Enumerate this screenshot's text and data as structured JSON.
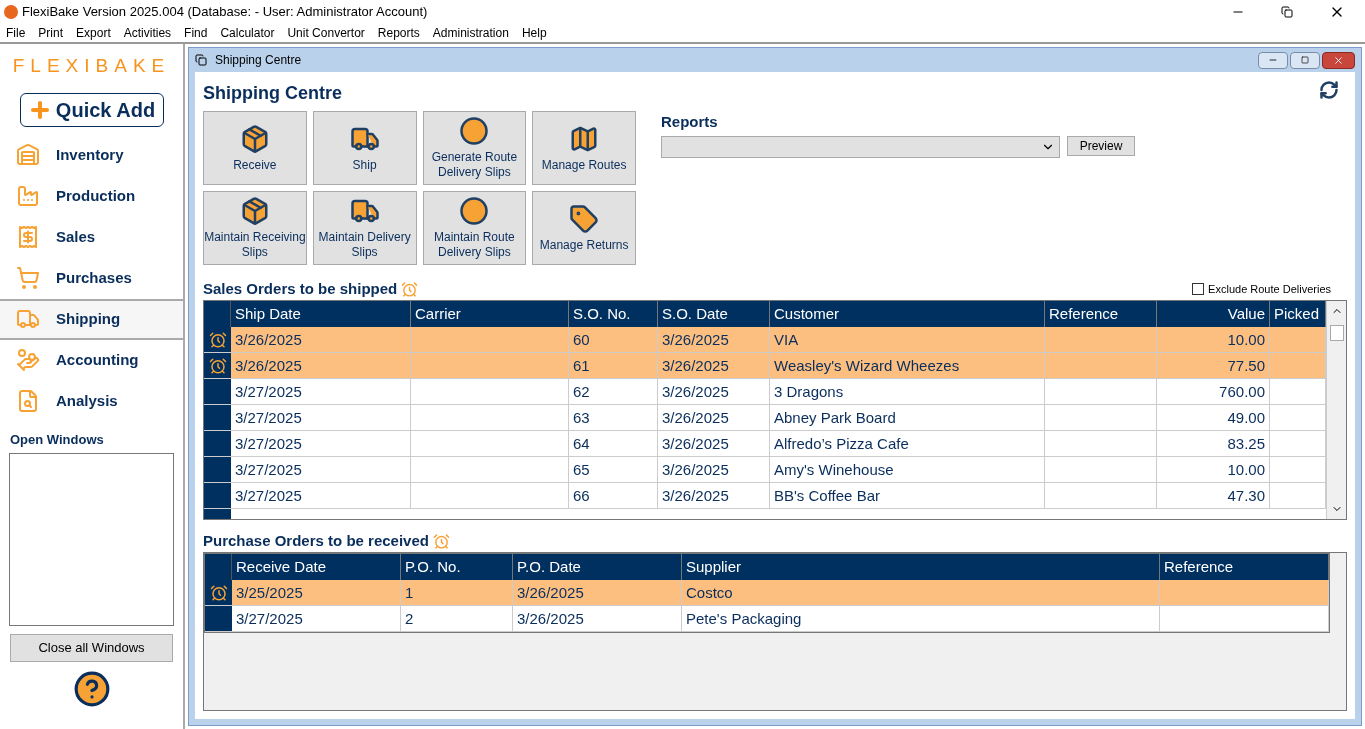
{
  "app_title": "FlexiBake Version 2025.004 (Database:  - User: Administrator Account)",
  "menu": [
    "File",
    "Print",
    "Export",
    "Activities",
    "Find",
    "Calculator",
    "Unit Convertor",
    "Reports",
    "Administration",
    "Help"
  ],
  "sidebar": {
    "logo": "FLEXIBAKE",
    "quick_add": "Quick Add",
    "items": [
      {
        "label": "Inventory",
        "kind": "inventory",
        "selected": false
      },
      {
        "label": "Production",
        "kind": "production",
        "selected": false
      },
      {
        "label": "Sales",
        "kind": "sales",
        "selected": false
      },
      {
        "label": "Purchases",
        "kind": "purchases",
        "selected": false
      },
      {
        "label": "Shipping",
        "kind": "shipping",
        "selected": true
      },
      {
        "label": "Accounting",
        "kind": "accounting",
        "selected": false
      },
      {
        "label": "Analysis",
        "kind": "analysis",
        "selected": false
      }
    ],
    "open_windows_label": "Open Windows",
    "close_all": "Close all Windows"
  },
  "window": {
    "title": "Shipping Centre",
    "heading": "Shipping Centre",
    "actions": [
      {
        "label": "Receive",
        "kind": "receive"
      },
      {
        "label": "Ship",
        "kind": "ship"
      },
      {
        "label": "Generate Route Delivery Slips",
        "kind": "route"
      },
      {
        "label": "Manage Routes",
        "kind": "map"
      },
      {
        "label": "Maintain Receiving Slips",
        "kind": "receive"
      },
      {
        "label": "Maintain Delivery Slips",
        "kind": "ship"
      },
      {
        "label": "Maintain Route Delivery Slips",
        "kind": "route"
      },
      {
        "label": "Manage Returns",
        "kind": "tag"
      }
    ],
    "reports": {
      "label": "Reports",
      "preview": "Preview"
    },
    "sales": {
      "title": "Sales Orders to be shipped",
      "exclude": {
        "label": "Exclude Route Deliveries",
        "checked": false
      },
      "columns": [
        "Ship Date",
        "Carrier",
        "S.O. No.",
        "S.O. Date",
        "Customer",
        "Reference",
        "Value",
        "Picked"
      ],
      "rows": [
        {
          "alarm": true,
          "cells": [
            "3/26/2025",
            "",
            "60",
            "3/26/2025",
            "VIA",
            "",
            "10.00",
            ""
          ]
        },
        {
          "alarm": true,
          "cells": [
            "3/26/2025",
            "",
            "61",
            "3/26/2025",
            "Weasley's Wizard Wheezes",
            "",
            "77.50",
            ""
          ]
        },
        {
          "alarm": false,
          "cells": [
            "3/27/2025",
            "",
            "62",
            "3/26/2025",
            "3 Dragons",
            "",
            "760.00",
            ""
          ]
        },
        {
          "alarm": false,
          "cells": [
            "3/27/2025",
            "",
            "63",
            "3/26/2025",
            "Abney Park Board",
            "",
            "49.00",
            ""
          ]
        },
        {
          "alarm": false,
          "cells": [
            "3/27/2025",
            "",
            "64",
            "3/26/2025",
            "Alfredo’s Pizza Cafe",
            "",
            "83.25",
            ""
          ]
        },
        {
          "alarm": false,
          "cells": [
            "3/27/2025",
            "",
            "65",
            "3/26/2025",
            "Amy's Winehouse",
            "",
            "10.00",
            ""
          ]
        },
        {
          "alarm": false,
          "cells": [
            "3/27/2025",
            "",
            "66",
            "3/26/2025",
            "BB's Coffee Bar",
            "",
            "47.30",
            ""
          ]
        }
      ]
    },
    "purchases": {
      "title": "Purchase Orders to be received",
      "columns": [
        "Receive Date",
        "P.O. No.",
        "P.O. Date",
        "Supplier",
        "Reference"
      ],
      "rows": [
        {
          "alarm": true,
          "cells": [
            "3/25/2025",
            "1",
            "3/26/2025",
            "Costco",
            ""
          ]
        },
        {
          "alarm": false,
          "cells": [
            "3/27/2025",
            "2",
            "3/26/2025",
            "Pete's Packaging",
            ""
          ]
        }
      ]
    }
  }
}
